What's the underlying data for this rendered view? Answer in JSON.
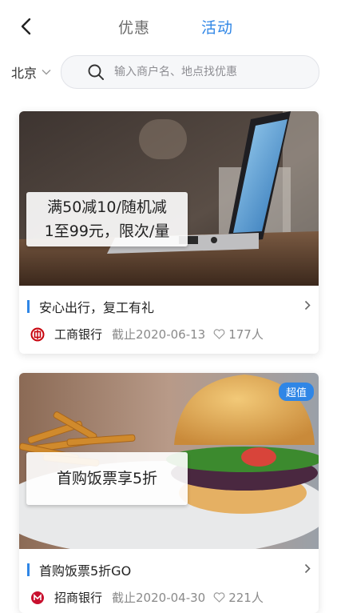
{
  "header": {
    "tabs": [
      {
        "label": "优惠",
        "active": false
      },
      {
        "label": "活动",
        "active": true
      }
    ]
  },
  "search": {
    "city": "北京",
    "placeholder": "输入商户名、地点找优惠"
  },
  "colors": {
    "accent": "#2f86e6",
    "icbc_red": "#c7000b",
    "cmb_red": "#c8102e"
  },
  "cards": [
    {
      "banner_lines": [
        "满50减10/随机减",
        "1至99元，限次/量"
      ],
      "title": "安心出行，复工有礼",
      "bank": "工商银行",
      "bank_logo_icon": "icbc-logo-icon",
      "deadline": "截止2020-06-13",
      "participants": "177人"
    },
    {
      "badge": "超值",
      "banner_lines": [
        "首购饭票享5折"
      ],
      "title": "首购饭票5折GO",
      "bank": "招商银行",
      "bank_logo_icon": "cmb-logo-icon",
      "deadline": "截止2020-04-30",
      "participants": "221人"
    }
  ]
}
